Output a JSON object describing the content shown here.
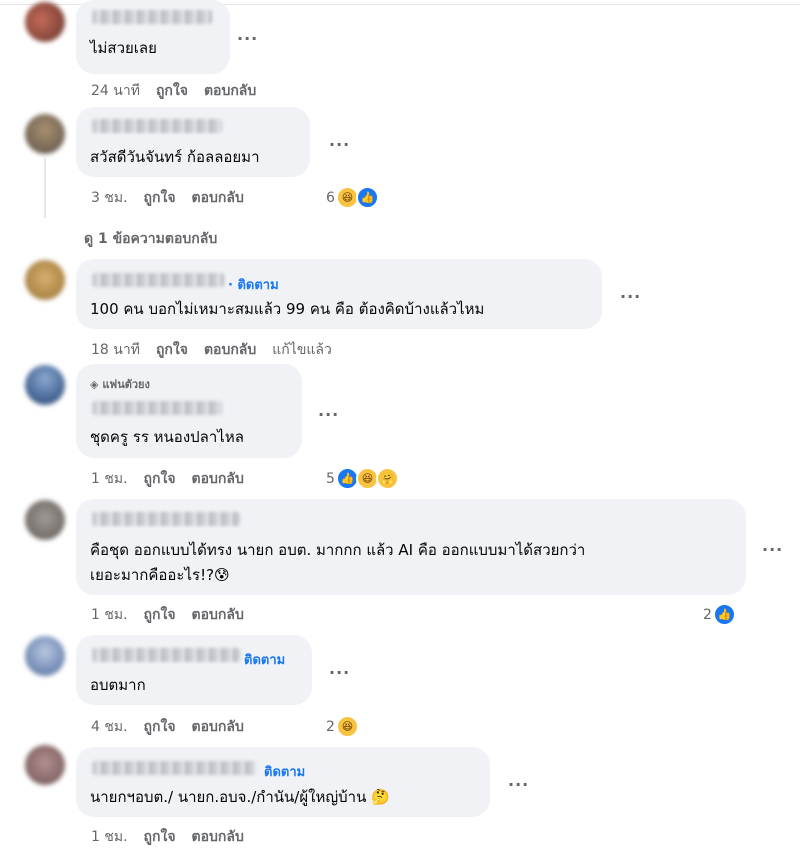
{
  "colors": {
    "link": "#1877f2",
    "bubble": "#f0f2f5",
    "meta": "#65676b"
  },
  "labels": {
    "like": "ถูกใจ",
    "reply": "ตอบกลับ",
    "more": "..."
  },
  "comments": [
    {
      "text": "ไม่สวยเลย",
      "time": "24 นาที"
    },
    {
      "text": "สวัสดีวันจันทร์ ก้อลลอยมา",
      "time": "3 ชม.",
      "reactions": "6",
      "reaction_icons": [
        "haha-icon",
        "like-icon"
      ]
    },
    {
      "text": "100 คน บอกไม่เหมาะสมแล้ว 99 คน คือ ต้องคิดบ้างแล้วไหม",
      "time": "18 นาที",
      "follow": "· ติดตาม",
      "edited": "แก้ไขแล้ว"
    },
    {
      "text": "ชุดครู รร หนองปลาไหล",
      "time": "1 ชม.",
      "badge": "แฟนตัวยง",
      "reactions": "5",
      "reaction_icons": [
        "like-icon",
        "haha-icon",
        "care-icon"
      ]
    },
    {
      "text_line1": "คือชุด ออกแบบได้ทรง นายก อบต. มากกก แล้ว AI คือ ออกแบบมาได้สวยกว่า",
      "text_line2": "เยอะมากคืออะไร!?😰",
      "time": "1 ชม.",
      "reactions": "2",
      "reaction_icons": [
        "like-icon"
      ]
    },
    {
      "text": "อบตมาก",
      "time": "4 ชม.",
      "follow": "ติดตาม",
      "reactions": "2",
      "reaction_icons": [
        "haha-icon"
      ]
    },
    {
      "text": "นายกฯอบต./ นายก.อบจ./กำนัน/ผู้ใหญ่บ้าน 🤔",
      "time": "1 ชม.",
      "follow": "ติดตาม"
    }
  ],
  "see_replies": "ดู 1 ข้อความตอบกลับ"
}
